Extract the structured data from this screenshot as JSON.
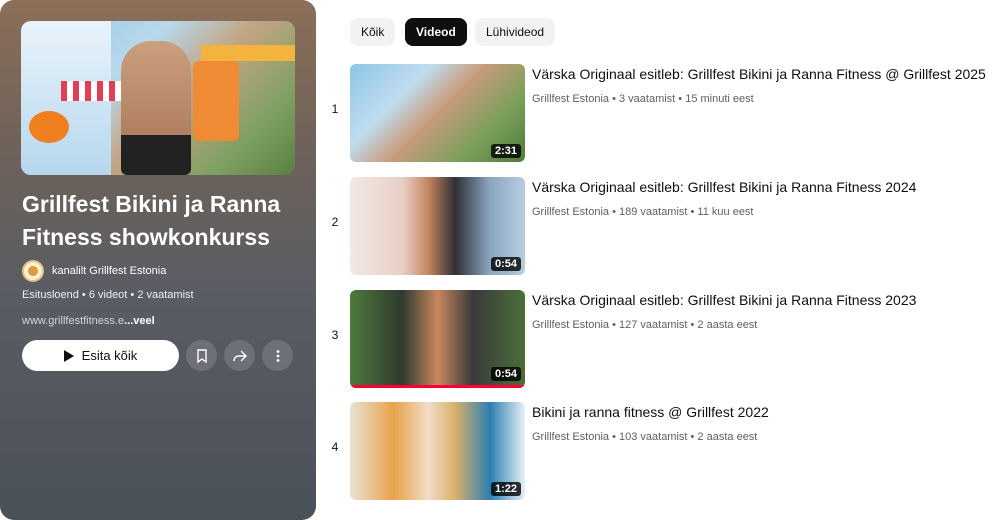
{
  "playlist": {
    "title": "Grillfest Bikini ja Ranna Fitness showkonkurss",
    "owner": "kanalilt Grillfest Estonia",
    "meta": "Esitusloend • 6 videot • 2 vaatamist",
    "description_link": "www.grillfestfitness.e",
    "description_more": "...veel",
    "play_all_label": "Esita kõik"
  },
  "chips": [
    {
      "label": "Kõik",
      "active": false
    },
    {
      "label": "Videod",
      "active": true
    },
    {
      "label": "Lühivideod",
      "active": false
    }
  ],
  "videos": [
    {
      "index": "1",
      "title": "Värska Originaal esitleb: Grillfest Bikini ja Ranna Fitness @ Grillfest 2025",
      "meta": "Grillfest Estonia • 3 vaatamist • 15 minuti eest",
      "duration": "2:31",
      "watched_fraction": 0
    },
    {
      "index": "2",
      "title": "Värska Originaal esitleb: Grillfest Bikini ja Ranna Fitness 2024",
      "meta": "Grillfest Estonia • 189 vaatamist • 11 kuu eest",
      "duration": "0:54",
      "watched_fraction": 0
    },
    {
      "index": "3",
      "title": "Värska Originaal esitleb: Grillfest Bikini ja Ranna Fitness 2023",
      "meta": "Grillfest Estonia • 127 vaatamist • 2 aasta eest",
      "duration": "0:54",
      "watched_fraction": 1
    },
    {
      "index": "4",
      "title": "Bikini ja ranna fitness @ Grillfest 2022",
      "meta": "Grillfest Estonia • 103 vaatamist • 2 aasta eest",
      "duration": "1:22",
      "watched_fraction": 0
    }
  ],
  "icons": [
    "play-icon",
    "bookmark-icon",
    "share-icon",
    "more-vert-icon"
  ],
  "colors": {
    "accent": "#ff0033",
    "chip_active": "#0f0f0f"
  }
}
